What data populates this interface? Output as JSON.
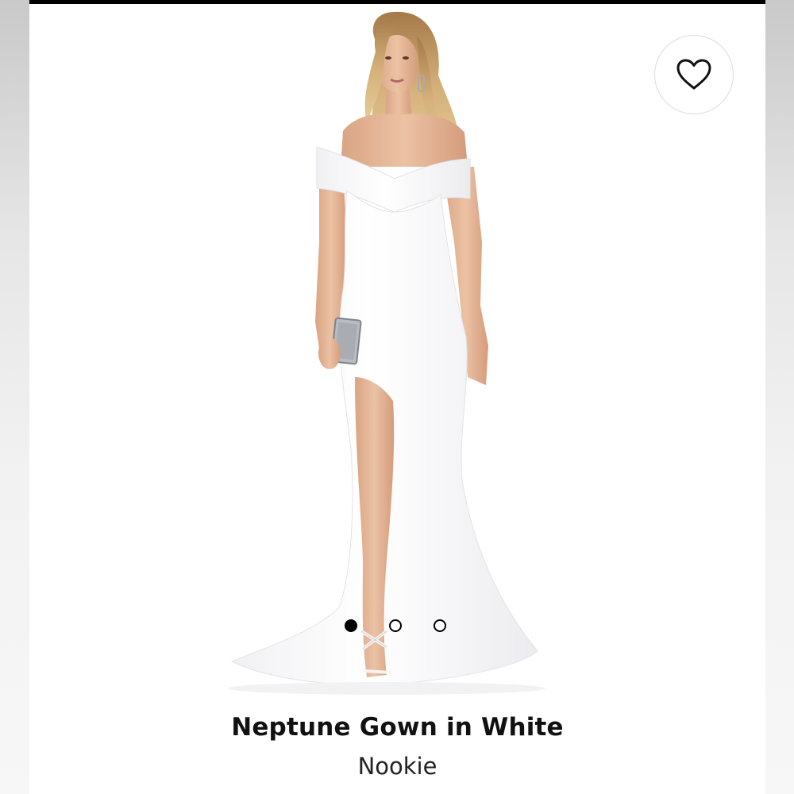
{
  "product": {
    "title": "Neptune Gown in White",
    "brand": "Nookie"
  },
  "favorite": {
    "icon": "heart-outline-icon",
    "selected": false
  },
  "gallery": {
    "image_count": 3,
    "current_index": 0
  },
  "colors": {
    "top_bar": "#000000",
    "card_background": "#ffffff",
    "dress": "#ffffff",
    "skin": "#e7b99a",
    "hair": "#c9a26b"
  }
}
